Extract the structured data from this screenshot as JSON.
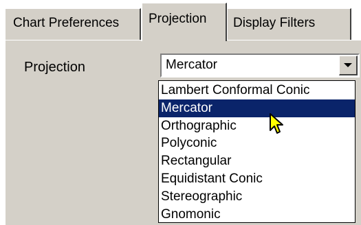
{
  "tabs": [
    {
      "label": "Chart Preferences",
      "active": false
    },
    {
      "label": "Projection",
      "active": true
    },
    {
      "label": "Display Filters",
      "active": false
    }
  ],
  "projection": {
    "label": "Projection",
    "selected": "Mercator",
    "dropdown_open": true,
    "options": [
      "Lambert Conformal Conic",
      "Mercator",
      "Orthographic",
      "Polyconic",
      "Rectangular",
      "Equidistant Conic",
      "Stereographic",
      "Gnomonic"
    ],
    "highlighted": "Mercator"
  },
  "colors": {
    "face": "#d4d0c8",
    "highlight": "#0a246a",
    "cursor": "#ffff00"
  },
  "icons": {
    "dropdown_arrow": "chevron-down-icon",
    "cursor": "arrow-pointer-icon"
  }
}
